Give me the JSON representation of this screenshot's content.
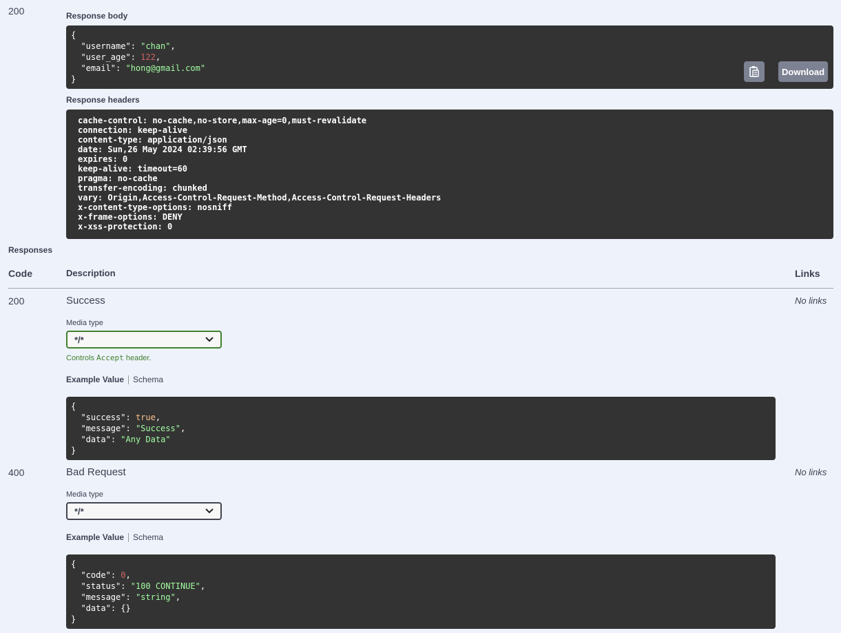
{
  "live_response": {
    "code": "200",
    "body_label": "Response body",
    "body_lines": [
      {
        "key": "\"username\"",
        "value": "\"chan\"",
        "type": "s",
        "comma": ","
      },
      {
        "key": "\"user_age\"",
        "value": "122",
        "type": "n",
        "comma": ","
      },
      {
        "key": "\"email\"",
        "value": "\"hong@gmail.com\"",
        "type": "s",
        "comma": ""
      }
    ],
    "copy_icon": "clipboard-icon",
    "download_label": "Download",
    "headers_label": "Response headers",
    "headers": [
      "cache-control: no-cache,no-store,max-age=0,must-revalidate",
      "connection: keep-alive",
      "content-type: application/json",
      "date: Sun,26 May 2024 02:39:56 GMT",
      "expires: 0",
      "keep-alive: timeout=60",
      "pragma: no-cache",
      "transfer-encoding: chunked",
      "vary: Origin,Access-Control-Request-Method,Access-Control-Request-Headers",
      "x-content-type-options: nosniff",
      "x-frame-options: DENY",
      "x-xss-protection: 0"
    ]
  },
  "responses": {
    "title": "Responses",
    "col_code": "Code",
    "col_description": "Description",
    "col_links": "Links",
    "items": [
      {
        "code": "200",
        "description": "Success",
        "links": "No links",
        "media_type_label": "Media type",
        "media_type_value": "*/*",
        "hint_prefix": "Controls ",
        "hint_code": "Accept",
        "hint_suffix": " header.",
        "tab_example": "Example Value",
        "tab_schema": "Schema",
        "example_lines": [
          {
            "key": "\"success\"",
            "value": "true",
            "type": "b",
            "comma": ","
          },
          {
            "key": "\"message\"",
            "value": "\"Success\"",
            "type": "s",
            "comma": ","
          },
          {
            "key": "\"data\"",
            "value": "\"Any Data\"",
            "type": "s",
            "comma": ""
          }
        ]
      },
      {
        "code": "400",
        "description": "Bad Request",
        "links": "No links",
        "media_type_label": "Media type",
        "media_type_value": "*/*",
        "tab_example": "Example Value",
        "tab_schema": "Schema",
        "example_lines": [
          {
            "key": "\"code\"",
            "value": "0",
            "type": "n",
            "comma": ","
          },
          {
            "key": "\"status\"",
            "value": "\"100 CONTINUE\"",
            "type": "s",
            "comma": ","
          },
          {
            "key": "\"message\"",
            "value": "\"string\"",
            "type": "s",
            "comma": ","
          },
          {
            "key": "\"data\"",
            "value": "{}",
            "type": "k",
            "comma": ""
          }
        ]
      }
    ]
  },
  "colors": {
    "background": "#eef3fb",
    "code_bg": "#333333",
    "string": "#a2fca2",
    "number": "#d36363",
    "boolean": "#fcc28c",
    "accent_green": "#41802f"
  }
}
